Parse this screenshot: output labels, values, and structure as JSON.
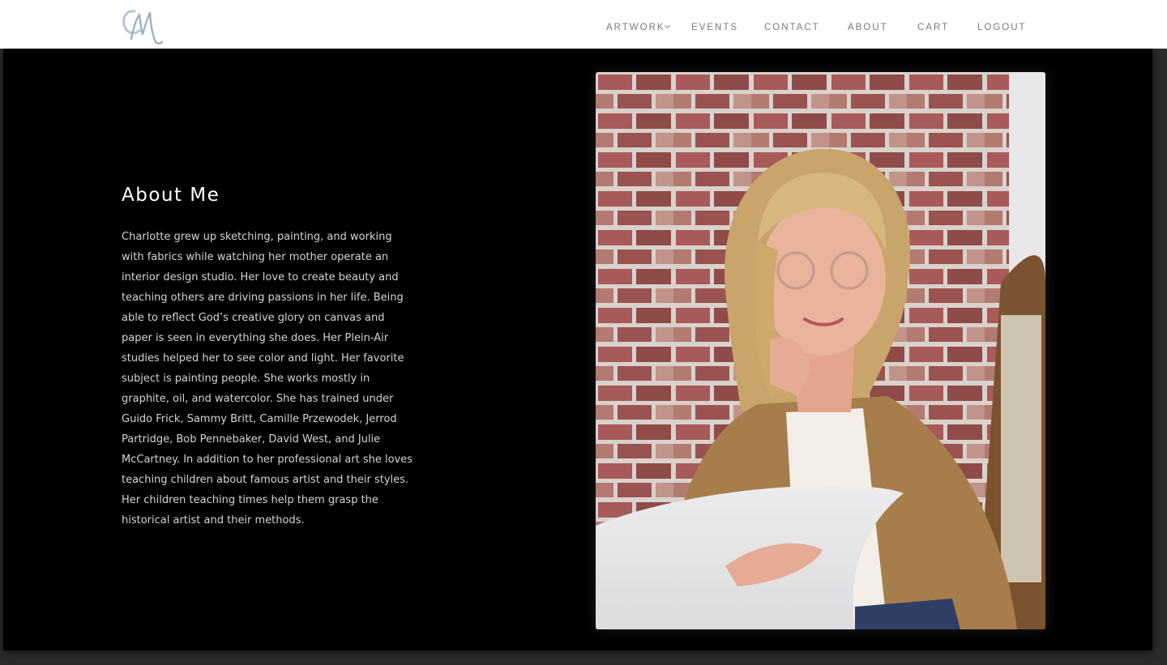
{
  "header": {
    "logo_icon": "cm-monogram-logo",
    "nav": [
      {
        "label": "ARTWORK",
        "has_dropdown": true
      },
      {
        "label": "EVENTS"
      },
      {
        "label": "CONTACT"
      },
      {
        "label": "ABOUT"
      },
      {
        "label": "CART"
      },
      {
        "label": "LOGOUT"
      }
    ]
  },
  "about": {
    "title": "About Me",
    "body": "Charlotte grew up sketching, painting, and working with fabrics while watching her mother operate an interior design studio. Her love to create beauty and teaching others are driving passions in her life. Being able to reflect God’s creative glory on canvas and paper is seen in everything she does. Her Plein-Air studies helped her to see color and light. Her favorite subject is painting people. She works mostly in graphite, oil, and watercolor. She has trained under Guido Frick, Sammy Britt, Camille Przewodek, Jerrod Partridge, Bob Pennebaker, David West, and Julie McCartney. In addition to her professional art she loves teaching children about famous artist and their styles. Her children teaching times help them grasp the historical artist and their methods."
  },
  "colors": {
    "panel_bg": "#000000",
    "page_bg": "#2b2b2b",
    "nav_text": "#7a7a7a",
    "title": "#ffffff",
    "body_text": "#d4d4d4"
  }
}
